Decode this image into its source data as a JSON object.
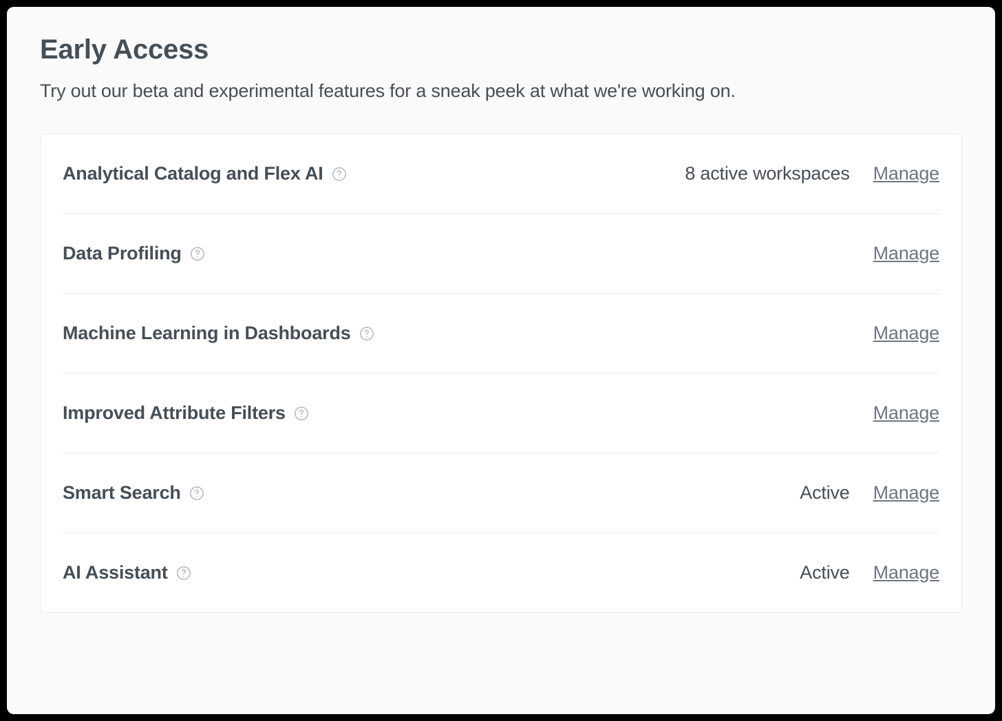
{
  "header": {
    "title": "Early Access",
    "subtitle": "Try out our beta and experimental features for a sneak peek at what we're working on."
  },
  "features": [
    {
      "name": "Analytical Catalog and Flex AI",
      "status": "8 active workspaces",
      "action": "Manage"
    },
    {
      "name": "Data Profiling",
      "status": "",
      "action": "Manage"
    },
    {
      "name": "Machine Learning in Dashboards",
      "status": "",
      "action": "Manage"
    },
    {
      "name": "Improved Attribute Filters",
      "status": "",
      "action": "Manage"
    },
    {
      "name": "Smart Search",
      "status": "Active",
      "action": "Manage"
    },
    {
      "name": "AI Assistant",
      "status": "Active",
      "action": "Manage"
    }
  ]
}
